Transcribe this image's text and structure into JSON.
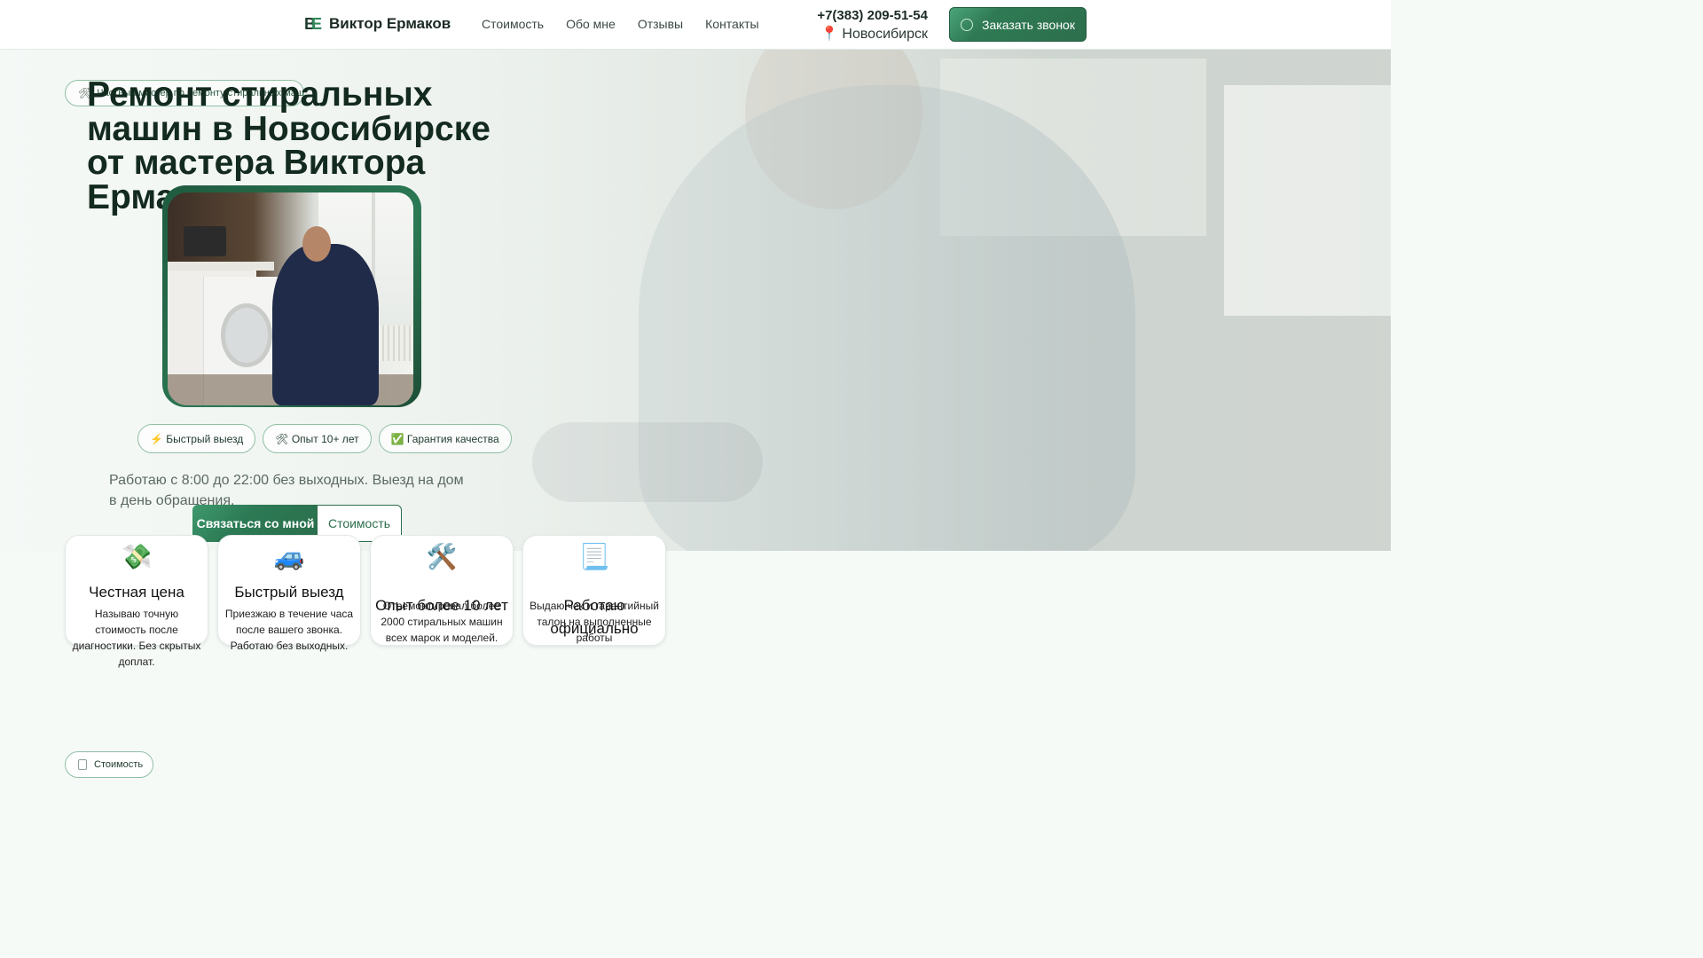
{
  "header": {
    "logo_text": "Виктор Ермаков",
    "logo_initials_1": "В",
    "logo_initials_2": "Е",
    "nav": [
      "Стоимость",
      "Обо мне",
      "Отзывы",
      "Контакты"
    ],
    "phone": "+7(383) 209-51-54",
    "city_icon": "📍",
    "city": "Новосибирск",
    "call_button": "Заказать звонок"
  },
  "hero": {
    "eyebrow_icon": "🛠",
    "eyebrow_text": "Частный мастер по ремонту стиральных машин",
    "title": "Ремонт стиральных машин в Новосибирске от мастера Виктора Ермакова",
    "badges": [
      "⚡ Быстрый выезд",
      "🛠 Опыт 10+ лет",
      "✅ Гарантия качества"
    ],
    "subtitle": "Работаю с 8:00 до 22:00 без выходных. Выезд на дом в день обращения.",
    "cta_primary": "Связаться со мной",
    "cta_secondary": "Стоимость"
  },
  "features": [
    {
      "icon": "💸",
      "title": "Честная цена",
      "text": "Называю точную стоимость после диагностики. Без скрытых доплат."
    },
    {
      "icon": "🚙",
      "title": "Быстрый выезд",
      "text": "Приезжаю в течение часа после вашего звонка. Работаю без выходных."
    },
    {
      "icon": "🛠️",
      "title": "Опыт более 10 лет",
      "text": "Отремонтировал более 2000 стиральных машин всех марок и моделей."
    },
    {
      "icon": "📃",
      "title": "Работаю официально",
      "text": "Выдаю чек и гарантийный талон на выполненные работы"
    }
  ],
  "bottom_pill": "Стоимость",
  "colors": {
    "accent": "#2c7a55",
    "accent_dark": "#132a1f",
    "border": "#8fbfa4"
  }
}
